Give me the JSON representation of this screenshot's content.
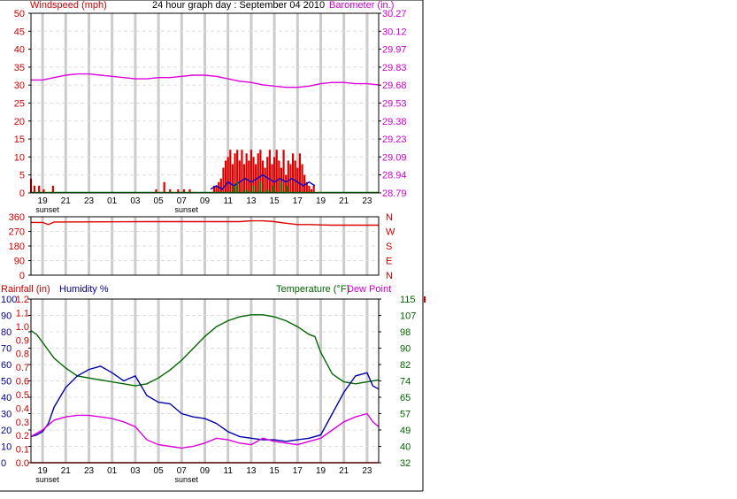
{
  "header": {
    "windspeed_label": "Windspeed (mph)",
    "title": "24 hour graph day : September 04 2010",
    "barometer_label": "Barometer (in.)"
  },
  "bottom_header": {
    "rainfall_label": "Rainfall (in)",
    "humidity_label": "Humidity %",
    "temperature_label": "Temperature (°F)",
    "dewpoint_label": "Dew Point"
  },
  "colors": {
    "wind": "#dd0000",
    "gust": "#0000cc",
    "barometer": "#dd00dd",
    "rain": "#dd0000",
    "humidity": "#0000aa",
    "temperature": "#006600",
    "dewpoint": "#dd00dd",
    "green_bars": "#008800",
    "grid": "#cccccc"
  },
  "x_axis": {
    "tick_labels": [
      "19",
      "21",
      "23",
      "01",
      "03",
      "05",
      "07",
      "09",
      "11",
      "13",
      "15",
      "17",
      "19",
      "21",
      "23"
    ],
    "sunset_label": "sunset",
    "sunset_positions": [
      0.5,
      12.5
    ]
  },
  "chart_data": [
    {
      "type": "line",
      "name": "wind-barometer",
      "x_unit": "hours since 18:00 Sep 03",
      "x_range": [
        0,
        30
      ],
      "left_axis": {
        "label": "Windspeed (mph)",
        "ticks": [
          0,
          5,
          10,
          15,
          20,
          25,
          30,
          35,
          40,
          45,
          50
        ],
        "range": [
          0,
          50
        ]
      },
      "right_axis": {
        "label": "Barometer (in.)",
        "ticks": [
          "28.79",
          "28.94",
          "29.09",
          "29.23",
          "29.38",
          "29.53",
          "29.68",
          "29.83",
          "29.97",
          "30.12",
          "30.27"
        ],
        "range": [
          28.79,
          30.27
        ]
      },
      "series": [
        {
          "name": "Barometer",
          "axis": "right",
          "x": [
            0,
            1,
            2,
            3,
            4,
            5,
            6,
            7,
            8,
            9,
            10,
            11,
            12,
            13,
            14,
            15,
            16,
            17,
            18,
            19,
            20,
            21,
            22,
            23,
            24,
            25,
            26,
            27,
            28,
            29,
            30
          ],
          "y": [
            29.72,
            29.72,
            29.74,
            29.76,
            29.77,
            29.77,
            29.76,
            29.75,
            29.74,
            29.73,
            29.73,
            29.74,
            29.74,
            29.75,
            29.76,
            29.76,
            29.75,
            29.73,
            29.71,
            29.7,
            29.68,
            29.67,
            29.66,
            29.66,
            29.67,
            29.69,
            29.7,
            29.7,
            29.69,
            29.69,
            29.68
          ]
        },
        {
          "name": "Windspeed",
          "axis": "left",
          "style": "bars",
          "x": [
            0,
            0.3,
            0.7,
            1.1,
            1.9,
            10.8,
            11.5,
            12.0,
            12.7,
            13.2,
            13.7,
            15.8,
            16.0,
            16.2,
            16.4,
            16.6,
            16.8,
            17.0,
            17.2,
            17.4,
            17.6,
            17.8,
            18.0,
            18.2,
            18.4,
            18.6,
            18.8,
            19.0,
            19.2,
            19.4,
            19.6,
            19.8,
            20.0,
            20.2,
            20.4,
            20.6,
            20.8,
            21.0,
            21.2,
            21.4,
            21.6,
            21.8,
            22.0,
            22.2,
            22.4,
            22.6,
            22.8,
            23.0,
            23.2,
            23.4,
            23.6,
            23.8,
            24.0,
            24.2,
            24.4
          ],
          "y": [
            4,
            2,
            2,
            1,
            2,
            1,
            3,
            1,
            1,
            1,
            1,
            2,
            2,
            3,
            4,
            7,
            9,
            10,
            12,
            8,
            11,
            12,
            9,
            12,
            8,
            11,
            9,
            12,
            10,
            8,
            11,
            12,
            9,
            7,
            10,
            12,
            8,
            10,
            12,
            9,
            7,
            12,
            5,
            9,
            8,
            11,
            9,
            7,
            11,
            8,
            5,
            3,
            2,
            1,
            2
          ]
        },
        {
          "name": "Gust",
          "axis": "left",
          "x": [
            15.5,
            16.0,
            16.5,
            17.0,
            17.5,
            18.0,
            18.5,
            19.0,
            19.5,
            20.0,
            20.5,
            21.0,
            21.5,
            22.0,
            22.5,
            23.0,
            23.5,
            24.0,
            24.5
          ],
          "y": [
            1,
            2,
            1,
            3,
            2,
            3,
            4,
            3,
            4,
            5,
            4,
            3,
            4,
            3,
            4,
            3,
            2,
            3,
            2
          ]
        },
        {
          "name": "Green",
          "axis": "left",
          "style": "bars",
          "x": [
            17.5,
            17.8,
            18.6,
            19.2,
            19.8,
            20.4,
            20.9,
            21.6,
            22.1
          ],
          "y": [
            2,
            3,
            1,
            2,
            3,
            1,
            2,
            3,
            2
          ]
        }
      ]
    },
    {
      "type": "line",
      "name": "wind-direction",
      "x_unit": "hours since 18:00 Sep 03",
      "x_range": [
        0,
        30
      ],
      "left_axis": {
        "ticks": [
          0,
          90,
          180,
          270,
          360
        ],
        "range": [
          0,
          360
        ]
      },
      "right_axis": {
        "labels": [
          "N",
          "W",
          "S",
          "E",
          "N"
        ]
      },
      "series": [
        {
          "name": "Wind direction",
          "x": [
            0,
            1,
            1.5,
            2,
            10,
            14,
            16,
            18,
            19,
            20,
            21,
            22,
            23,
            24,
            25,
            26,
            30
          ],
          "y": [
            325,
            325,
            312,
            328,
            330,
            330,
            330,
            330,
            335,
            335,
            330,
            320,
            312,
            312,
            310,
            308,
            308
          ]
        }
      ]
    },
    {
      "type": "line",
      "name": "rain-humidity-temperature",
      "x_unit": "hours since 18:00 Sep 03",
      "x_range": [
        0,
        30
      ],
      "left_axis_humidity": {
        "label": "Humidity %",
        "ticks": [
          0,
          10,
          20,
          30,
          40,
          50,
          60,
          70,
          80,
          90,
          100
        ],
        "range": [
          0,
          100
        ]
      },
      "left_axis_rain": {
        "label": "Rainfall (in)",
        "ticks": [
          "0.0",
          "0.1",
          "0.2",
          "0.3",
          "0.4",
          "0.5",
          "0.6",
          "0.7",
          "0.8",
          "0.9",
          "1.0",
          "1.1",
          "1.2"
        ],
        "range": [
          0,
          1.2
        ]
      },
      "right_axis": {
        "label": "Temperature (°F)",
        "ticks": [
          32,
          40,
          49,
          57,
          65,
          74,
          82,
          90,
          98,
          107,
          115
        ],
        "range": [
          32,
          115
        ]
      },
      "series": [
        {
          "name": "Temperature",
          "axis": "right",
          "x": [
            0,
            0.5,
            1,
            1.5,
            2,
            3,
            4,
            5,
            6,
            7,
            8,
            9,
            10,
            11,
            12,
            13,
            14,
            15,
            16,
            17,
            18,
            19,
            20,
            21,
            22,
            23,
            24,
            24.5,
            25,
            26,
            27,
            28,
            29,
            30
          ],
          "y": [
            99,
            97,
            93,
            89,
            85,
            80,
            76,
            75,
            74,
            73,
            72,
            71,
            72,
            75,
            79,
            84,
            90,
            96,
            101,
            104,
            106,
            107,
            107,
            106,
            104,
            101,
            97,
            96,
            88,
            77,
            73,
            72,
            73,
            74
          ]
        },
        {
          "name": "Humidity",
          "axis": "left",
          "x": [
            0,
            0.5,
            1,
            1.5,
            2,
            3,
            4,
            5,
            6,
            7,
            8,
            9,
            10,
            11,
            12,
            13,
            14,
            15,
            16,
            17,
            18,
            19,
            20,
            21,
            22,
            23,
            24,
            25,
            26,
            27,
            28,
            29,
            29.5,
            30
          ],
          "y": [
            16,
            17,
            19,
            24,
            34,
            46,
            53,
            57,
            59,
            55,
            50,
            53,
            41,
            37,
            36,
            30,
            28,
            27,
            24,
            19,
            16,
            15,
            14,
            14,
            13,
            14,
            15,
            17,
            30,
            43,
            53,
            55,
            47,
            45
          ]
        },
        {
          "name": "Dew Point",
          "axis": "left",
          "x": [
            0,
            1,
            2,
            3,
            4,
            5,
            6,
            7,
            8,
            9,
            10,
            11,
            12,
            13,
            14,
            15,
            16,
            17,
            18,
            19,
            20,
            21,
            22,
            23,
            24,
            25,
            26,
            27,
            28,
            29,
            29.5,
            30
          ],
          "y": [
            16,
            20,
            26,
            28,
            29,
            29,
            28,
            27,
            25,
            22,
            14,
            11,
            10,
            9,
            10,
            12,
            15,
            14,
            12,
            11,
            15,
            13,
            12,
            11,
            13,
            15,
            20,
            25,
            28,
            30,
            25,
            22
          ]
        },
        {
          "name": "Rainfall",
          "axis": "left_rain",
          "x": [
            0,
            30
          ],
          "y": [
            0,
            0
          ]
        }
      ]
    }
  ]
}
